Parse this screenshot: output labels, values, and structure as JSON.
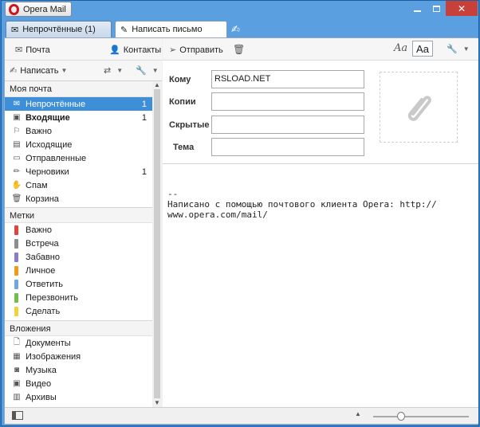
{
  "app": {
    "title": "Opera Mail"
  },
  "tabs": [
    {
      "label": "Непрочтённые (1)",
      "icon": "envelope-icon"
    },
    {
      "label": "Написать письмо",
      "icon": "pencil-icon"
    }
  ],
  "left_toolbar": {
    "mail_label": "Почта",
    "contacts_label": "Контакты",
    "compose_label": "Написать"
  },
  "sections": {
    "mail": "Моя почта",
    "labels": "Метки",
    "attachments": "Вложения"
  },
  "mail_folders": [
    {
      "label": "Непрочтённые",
      "count": "1",
      "icon": "unread-icon"
    },
    {
      "label": "Входящие",
      "count": "1",
      "icon": "inbox-icon"
    },
    {
      "label": "Важно",
      "count": "",
      "icon": "important-icon"
    },
    {
      "label": "Исходящие",
      "count": "",
      "icon": "outbox-icon"
    },
    {
      "label": "Отправленные",
      "count": "",
      "icon": "sent-icon"
    },
    {
      "label": "Черновики",
      "count": "1",
      "icon": "drafts-icon"
    },
    {
      "label": "Спам",
      "count": "",
      "icon": "spam-icon"
    },
    {
      "label": "Корзина",
      "count": "",
      "icon": "trash-icon"
    }
  ],
  "labels": [
    {
      "label": "Важно",
      "color": "#e0443c"
    },
    {
      "label": "Встреча",
      "color": "#8e8e8e"
    },
    {
      "label": "Забавно",
      "color": "#8a7bd2"
    },
    {
      "label": "Личное",
      "color": "#f29a18"
    },
    {
      "label": "Ответить",
      "color": "#6fa8e0"
    },
    {
      "label": "Перезвонить",
      "color": "#6ec04a"
    },
    {
      "label": "Сделать",
      "color": "#f2d23a"
    }
  ],
  "attachments": [
    {
      "label": "Документы",
      "icon": "document-icon"
    },
    {
      "label": "Изображения",
      "icon": "image-icon"
    },
    {
      "label": "Музыка",
      "icon": "music-icon"
    },
    {
      "label": "Видео",
      "icon": "video-icon"
    },
    {
      "label": "Архивы",
      "icon": "archive-icon"
    }
  ],
  "compose": {
    "send_label": "Отправить",
    "to_label": "Кому",
    "to_value": "RSLOAD.NET",
    "cc_label": "Копии",
    "cc_value": "",
    "bcc_label": "Скрытые",
    "bcc_value": "",
    "subject_label": "Тема",
    "subject_value": "",
    "body": "--\nНаписано с помощью почтового клиента Opera: http://\nwww.opera.com/mail/"
  }
}
